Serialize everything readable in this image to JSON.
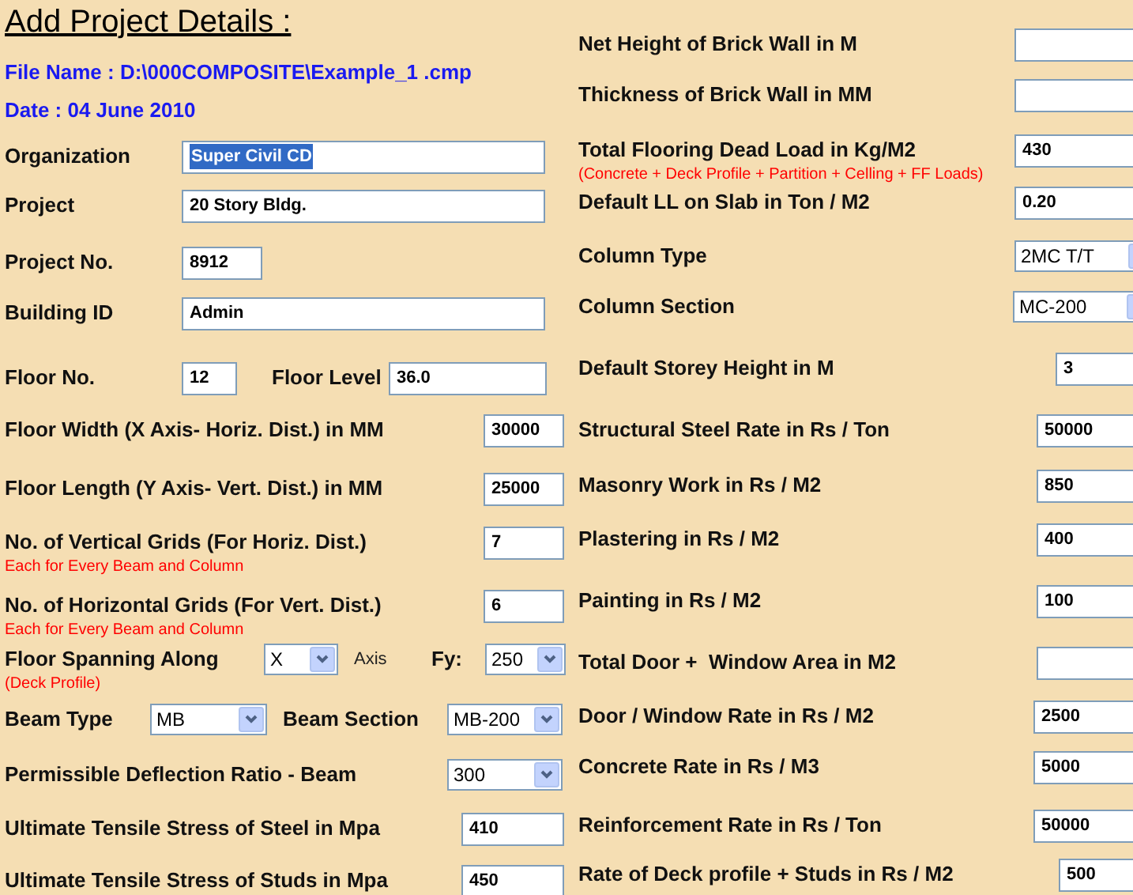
{
  "title": "Add Project Details :",
  "file_name": "File Name : D:\\000COMPOSITE\\Example_1 .cmp",
  "date": "Date : 04 June 2010",
  "organization": {
    "label": "Organization",
    "value": "Super Civil CD",
    "highlighted": true
  },
  "project": {
    "label": "Project",
    "value": "20 Story Bldg."
  },
  "project_no": {
    "label": "Project No.",
    "value": "8912"
  },
  "building_id": {
    "label": "Building ID",
    "value": "Admin"
  },
  "floor_no": {
    "label": "Floor No.",
    "value": "12"
  },
  "floor_level": {
    "label": "Floor Level",
    "value": "36.0"
  },
  "floor_width": {
    "label": "Floor Width (X Axis- Horiz. Dist.) in MM",
    "value": "30000"
  },
  "floor_length": {
    "label": "Floor Length (Y Axis- Vert. Dist.) in MM",
    "value": "25000"
  },
  "vertical_grids": {
    "label": "No. of Vertical Grids (For Horiz. Dist.)",
    "note": "Each for Every Beam and Column",
    "value": "7"
  },
  "horizontal_grids": {
    "label": "No. of Horizontal Grids (For Vert. Dist.)",
    "note": "Each for Every Beam and Column",
    "value": "6"
  },
  "floor_spanning": {
    "label": "Floor Spanning Along",
    "note": "(Deck Profile)",
    "value": "X",
    "suffix": "Axis"
  },
  "fy": {
    "label": "Fy:",
    "value": "250"
  },
  "beam_type": {
    "label": "Beam Type",
    "value": "MB"
  },
  "beam_section": {
    "label": "Beam Section",
    "value": "MB-200"
  },
  "deflection_ratio": {
    "label": "Permissible Deflection Ratio - Beam",
    "value": "300"
  },
  "steel_uts": {
    "label": "Ultimate Tensile Stress of Steel in Mpa",
    "value": "410"
  },
  "studs_uts": {
    "label": "Ultimate Tensile Stress of Studs in Mpa",
    "value": "450"
  },
  "right_fields": [
    {
      "kind": "text",
      "label": "Net Height of Brick Wall in M"
    },
    {
      "kind": "text",
      "label": "Thickness of Brick Wall in MM"
    },
    {
      "kind": "text",
      "label": "Total Flooring Dead Load in Kg/M2",
      "note": "(Concrete + Deck Profile + Partition + Celling + FF Loads)",
      "value": "430"
    },
    {
      "kind": "text",
      "label": "Default LL on Slab in Ton / M2",
      "value": "0.20"
    },
    {
      "kind": "select",
      "label": "Column Type",
      "value": "2MC T/T"
    },
    {
      "kind": "select",
      "label": "Column Section",
      "value": "MC-200"
    },
    {
      "kind": "text",
      "label": "Default Storey Height in M",
      "value": "3"
    },
    {
      "kind": "text",
      "label": "Structural Steel Rate in Rs / Ton",
      "value": "50000"
    },
    {
      "kind": "text",
      "label": "Masonry Work in Rs / M2",
      "value": "850"
    },
    {
      "kind": "text",
      "label": "Plastering in Rs / M2",
      "value": "400"
    },
    {
      "kind": "text",
      "label": "Painting in Rs / M2",
      "value": "100"
    },
    {
      "kind": "text",
      "label": "Total Door +  Window Area in M2"
    },
    {
      "kind": "text",
      "label": "Door / Window Rate in Rs / M2",
      "value": "2500"
    },
    {
      "kind": "text",
      "label": "Concrete Rate in Rs / M3",
      "value": "5000"
    },
    {
      "kind": "text",
      "label": "Reinforcement Rate in Rs / Ton",
      "value": "50000"
    },
    {
      "kind": "text",
      "label": "Rate of Deck profile + Studs in Rs / M2",
      "value": "500"
    }
  ]
}
